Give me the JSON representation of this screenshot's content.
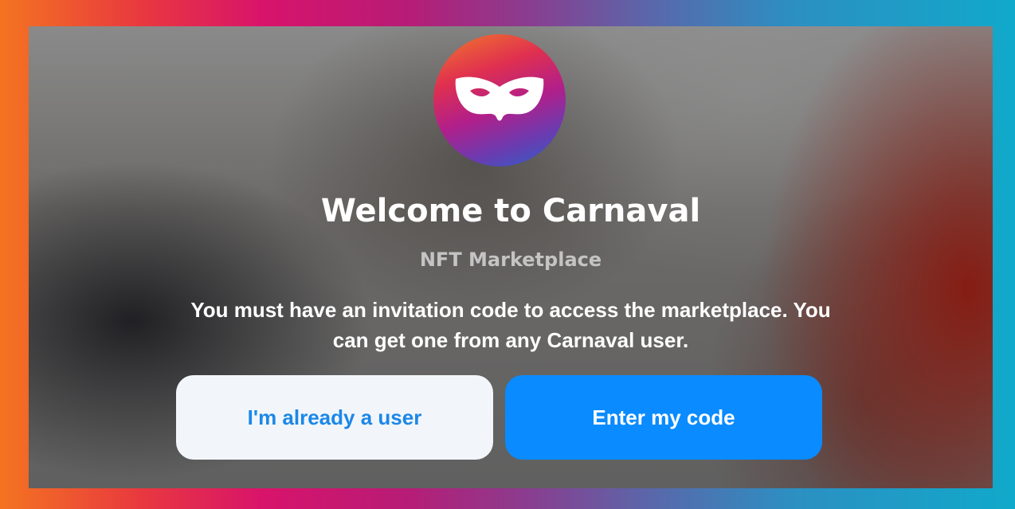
{
  "welcome": {
    "title": "Welcome to Carnaval",
    "subtitle": "NFT Marketplace",
    "description": "You must have an invitation code to access the marketplace. You can get one from any Carnaval user."
  },
  "actions": {
    "existing_user_label": "I'm already a user",
    "enter_code_label": "Enter my code"
  },
  "icons": {
    "logo": "carnival-mask-icon"
  },
  "colors": {
    "primary_button": "#0a8bff",
    "secondary_button_bg": "#f2f6fa",
    "secondary_button_text": "#1c87e8"
  }
}
